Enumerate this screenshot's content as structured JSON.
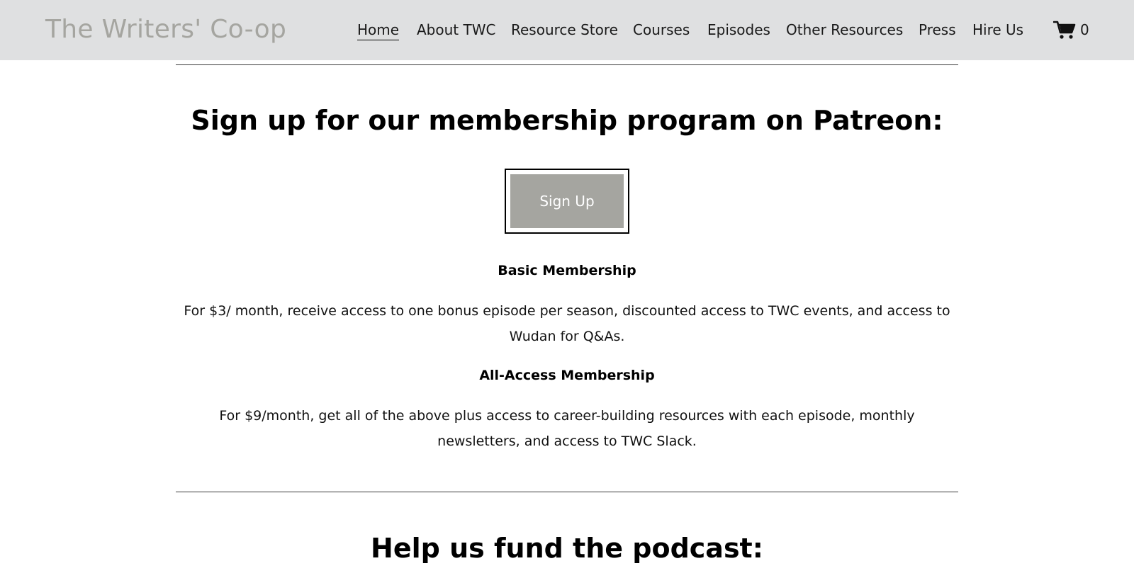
{
  "site": {
    "logo": "The Writers' Co-op"
  },
  "nav": {
    "items": [
      {
        "label": "Home",
        "active": true
      },
      {
        "label": "About TWC"
      },
      {
        "label": "Resource Store"
      },
      {
        "label": "Courses"
      },
      {
        "label": "Episodes"
      },
      {
        "label": "Other Resources"
      },
      {
        "label": "Press"
      },
      {
        "label": "Hire Us"
      }
    ],
    "cart_count": "0"
  },
  "membership": {
    "heading": "Sign up for our membership program on Patreon:",
    "signup_label": "Sign Up",
    "tiers": [
      {
        "title": "Basic Membership",
        "description": "For $3/ month, receive access to one bonus episode per season, discounted access to TWC events, and access to Wudan for Q&As."
      },
      {
        "title": "All-Access Membership",
        "description": "For $9/month, get all of the above plus access to career-building resources with each episode, monthly newsletters, and access to TWC Slack."
      }
    ]
  },
  "fund": {
    "heading": "Help us fund the podcast:"
  },
  "colors": {
    "header_bg": "#dfe0e1",
    "logo": "#a5a5a0",
    "button_bg": "#a5a5a0"
  }
}
